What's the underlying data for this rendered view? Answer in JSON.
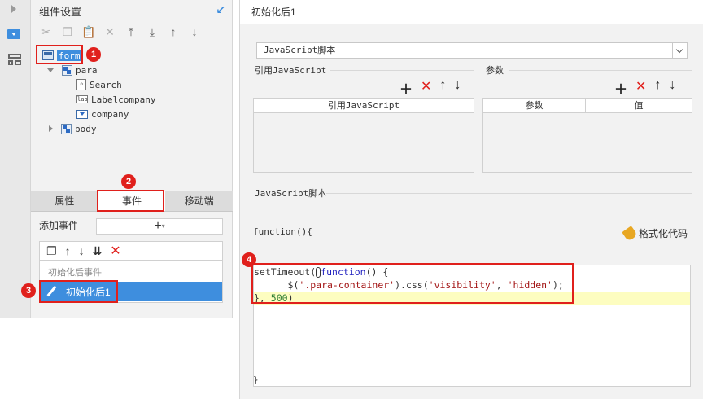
{
  "left_panel": {
    "title": "组件设置",
    "tree": {
      "form": "form",
      "para": "para",
      "search": "Search",
      "labelcompany": "Labelcompany",
      "company": "company",
      "body": "body",
      "lab_icon_text": "lab"
    },
    "tabs": [
      "属性",
      "事件",
      "移动端"
    ],
    "add_event_label": "添加事件",
    "add_event_button": "+",
    "event_group": "初始化后事件",
    "selected_event": "初始化后1"
  },
  "badges": [
    "1",
    "2",
    "3",
    "4"
  ],
  "right_panel": {
    "title": "初始化后1",
    "script_type": "JavaScript脚本",
    "ref_js_label": "引用JavaScript",
    "params_label": "参数",
    "ref_js_column": "引用JavaScript",
    "params_columns": [
      "参数",
      "值"
    ],
    "script_section_label": "JavaScript脚本",
    "function_open": "function(){",
    "format_code": "格式化代码",
    "function_close": "}",
    "code": {
      "line1_a": "setTimeout(",
      "line1_kw": "function",
      "line1_b": "() {",
      "line2_indent": "      $(",
      "line2_str1": "'.para-container'",
      "line2_mid": ").css(",
      "line2_str2": "'visibility'",
      "line2_comma": ", ",
      "line2_str3": "'hidden'",
      "line2_end": ");",
      "line3_a": "}, ",
      "line3_num": "500",
      "line3_b": ")"
    }
  },
  "colors": {
    "accent": "#3e8ede",
    "annotation": "#e0201c",
    "highlight": "#fdfdc0"
  }
}
